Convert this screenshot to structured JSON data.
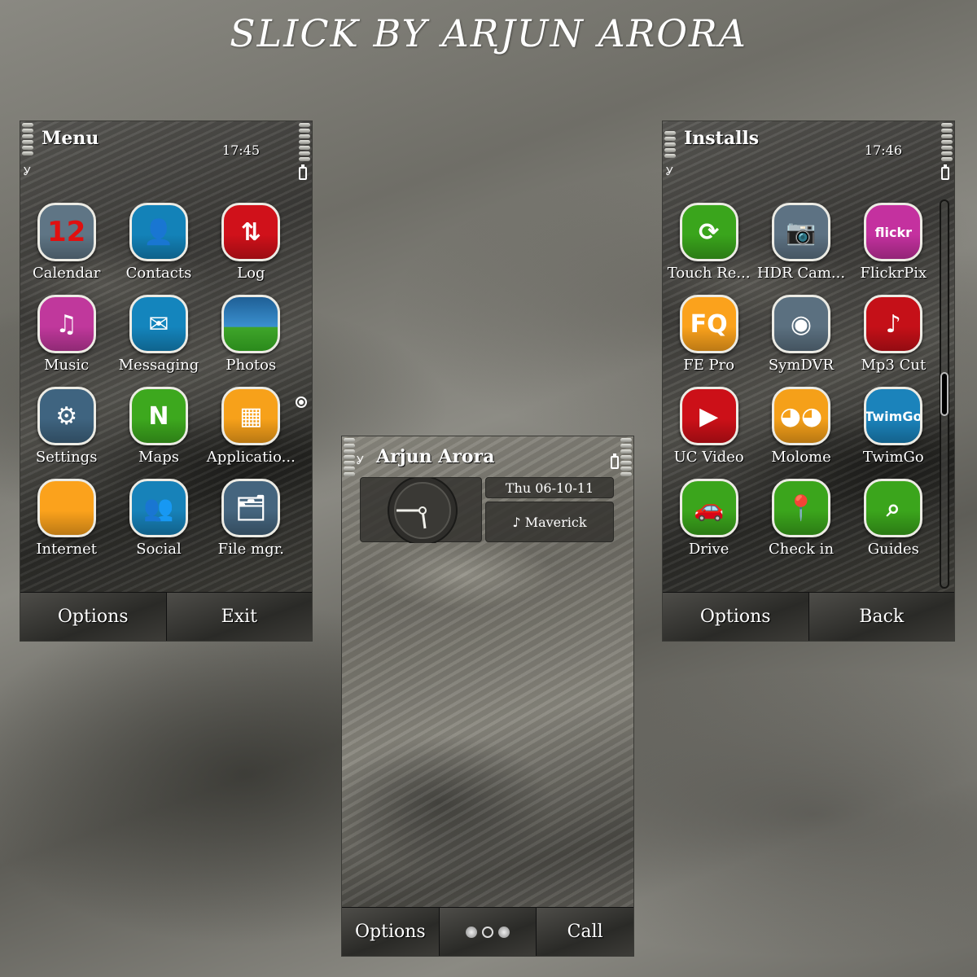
{
  "page_title": "SLICK BY ARJUN ARORA",
  "menu_screen": {
    "title": "Menu",
    "time": "17:45",
    "apps": [
      {
        "label": "Calendar",
        "icon": "calendar-icon",
        "glyph": "12",
        "color": "#5f7585"
      },
      {
        "label": "Contacts",
        "icon": "contact-person-icon",
        "glyph": "👤",
        "color": "#1382b8"
      },
      {
        "label": "Log",
        "icon": "log-arrows-icon",
        "glyph": "⇅",
        "color": "#d0111a"
      },
      {
        "label": "Music",
        "icon": "music-note-icon",
        "glyph": "♫",
        "color": "#c0389c"
      },
      {
        "label": "Messaging",
        "icon": "envelope-icon",
        "glyph": "✉",
        "color": "#1485bd"
      },
      {
        "label": "Photos",
        "icon": "landscape-photo-icon",
        "glyph": "",
        "color": "#2a82c8"
      },
      {
        "label": "Settings",
        "icon": "gear-icon",
        "glyph": "⚙",
        "color": "#3f6480"
      },
      {
        "label": "Maps",
        "icon": "compass-icon",
        "glyph": "N",
        "color": "#3da81e"
      },
      {
        "label": "Applicatio...",
        "icon": "applications-folder-icon",
        "glyph": "▦",
        "color": "#f7a11a"
      },
      {
        "label": "Internet",
        "icon": "folder-icon",
        "glyph": "",
        "color": "#fba21c"
      },
      {
        "label": "Social",
        "icon": "people-group-icon",
        "glyph": "👥",
        "color": "#1782b9"
      },
      {
        "label": "File mgr.",
        "icon": "file-cabinet-icon",
        "glyph": "🗂",
        "color": "#45657e"
      }
    ],
    "softkeys": {
      "left": "Options",
      "right": "Exit"
    }
  },
  "home_screen": {
    "owner_name": "Arjun Arora",
    "date": "Thu 06-10-11",
    "music_track": "♪ Maverick",
    "clock_time": "17:45",
    "softkeys": {
      "left": "Options",
      "right": "Call"
    },
    "page_indicator": {
      "pages": 3,
      "active": 2
    }
  },
  "installs_screen": {
    "title": "Installs",
    "time": "17:46",
    "apps": [
      {
        "label": "Touch Re...",
        "icon": "refresh-arrows-icon",
        "glyph": "⟳",
        "color": "#3aa51c"
      },
      {
        "label": "HDR Cam...",
        "icon": "camera-icon",
        "glyph": "📷",
        "color": "#5d7283"
      },
      {
        "label": "FlickrPix",
        "icon": "flickr-icon",
        "glyph": "flickr",
        "color": "#c4319f"
      },
      {
        "label": "FE Pro",
        "icon": "fe-folder-icon",
        "glyph": "FQ",
        "color": "#fba21c"
      },
      {
        "label": "SymDVR",
        "icon": "record-lens-icon",
        "glyph": "◉",
        "color": "#5b7080"
      },
      {
        "label": "Mp3 Cut",
        "icon": "music-scissors-icon",
        "glyph": "♪",
        "color": "#c51018"
      },
      {
        "label": "UC Video",
        "icon": "headphones-play-icon",
        "glyph": "▶",
        "color": "#cc1018"
      },
      {
        "label": "Molome",
        "icon": "owl-icon",
        "glyph": "◕◕",
        "color": "#f5a019"
      },
      {
        "label": "TwimGo",
        "icon": "twimgo-icon",
        "glyph": "TwimGo",
        "color": "#1b83bb"
      },
      {
        "label": "Drive",
        "icon": "car-icon",
        "glyph": "🚗",
        "color": "#3ba51c"
      },
      {
        "label": "Check in",
        "icon": "location-pin-icon",
        "glyph": "📍",
        "color": "#3ba51c"
      },
      {
        "label": "Guides",
        "icon": "city-guide-icon",
        "glyph": "⌕",
        "color": "#3ba51c"
      }
    ],
    "scroll_position": 0.5,
    "softkeys": {
      "left": "Options",
      "right": "Back"
    }
  }
}
